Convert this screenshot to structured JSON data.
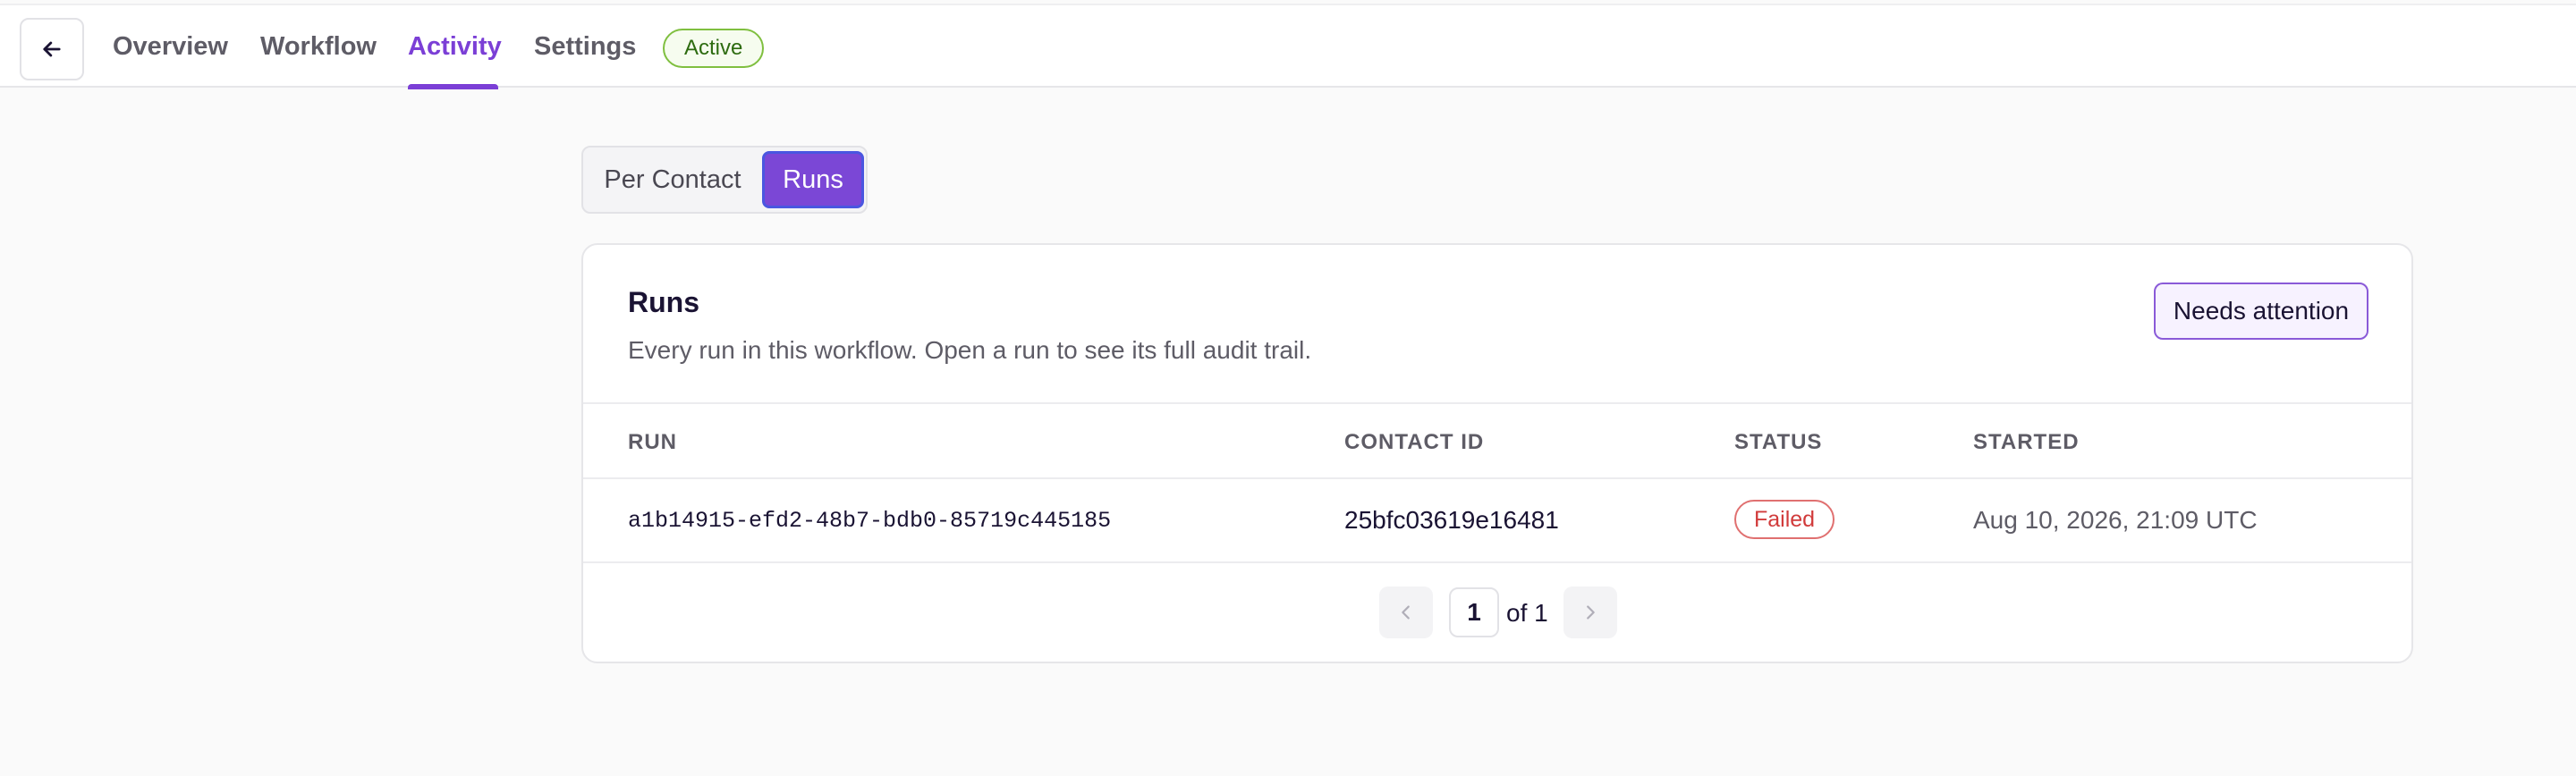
{
  "nav": {
    "back_icon": "arrow-left-icon",
    "tabs": [
      {
        "label": "Overview",
        "active": false
      },
      {
        "label": "Workflow",
        "active": false
      },
      {
        "label": "Activity",
        "active": true
      },
      {
        "label": "Settings",
        "active": false
      }
    ],
    "status": "Active",
    "accent_color": "#7b3fd6"
  },
  "view_toggle": {
    "options": [
      "Per Contact",
      "Runs"
    ],
    "selected": "Runs"
  },
  "runs_card": {
    "title": "Runs",
    "subtitle": "Every run in this workflow. Open a run to see its full audit trail.",
    "action_label": "Needs attention",
    "columns": [
      "RUN",
      "CONTACT ID",
      "STATUS",
      "STARTED"
    ],
    "rows": [
      {
        "run": "a1b14915-efd2-48b7-bdb0-85719c445185",
        "contact_id": "25bfc03619e16481",
        "status": "Failed",
        "started": "Aug 10, 2026, 21:09 UTC"
      }
    ],
    "status_colors": {
      "Failed": "#d13b3b"
    }
  },
  "pagination": {
    "current_page": "1",
    "of_label": "of 1",
    "prev_icon": "chevron-left-icon",
    "next_icon": "chevron-right-icon"
  }
}
